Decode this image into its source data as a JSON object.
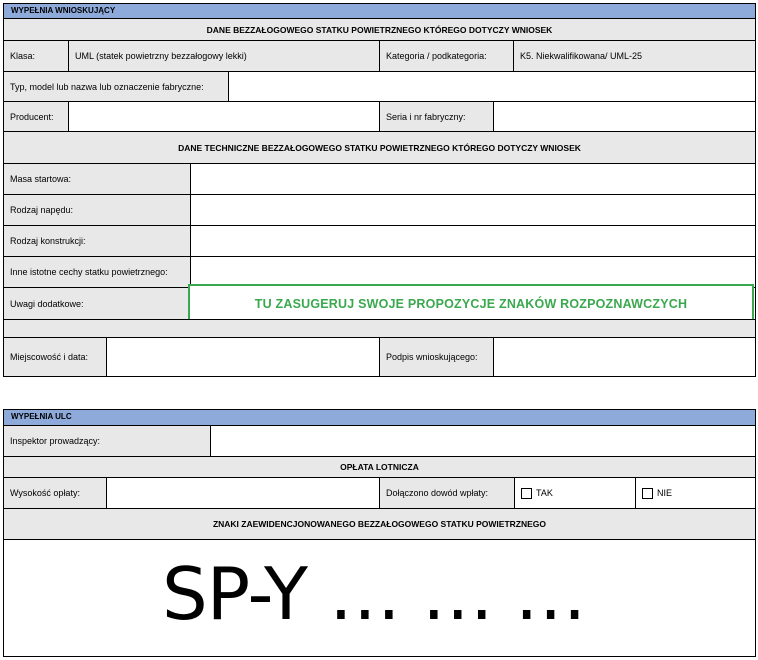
{
  "section1": {
    "header": "WYPEŁNIA WNIOSKUJĄCY",
    "aircraft_heading": "DANE BEZZAŁOGOWEGO STATKU POWIETRZNEGO KTÓREGO DOTYCZY WNIOSEK",
    "klasa_label": "Klasa:",
    "klasa_value": "UML (statek powietrzny bezzałogowy lekki)",
    "kategoria_label": "Kategoria / podkategoria:",
    "kategoria_value": "K5. Niekwalifikowana/ UML-25",
    "typ_label": "Typ, model lub nazwa lub oznaczenie fabryczne:",
    "producent_label": "Producent:",
    "seria_label": "Seria i nr fabryczny:",
    "tech_heading": "DANE TECHNICZNE BEZZAŁOGOWEGO STATKU POWIETRZNEGO KTÓREGO DOTYCZY WNIOSEK",
    "masa_label": "Masa startowa:",
    "naped_label": "Rodzaj napędu:",
    "konstrukcja_label": "Rodzaj konstrukcji:",
    "cechy_label": "Inne istotne cechy statku powietrznego:",
    "uwagi_label": "Uwagi dodatkowe:",
    "uwagi_overlay": "TU ZASUGERUJ SWOJE PROPOZYCJE ZNAKÓW ROZPOZNAWCZYCH",
    "miejscowosc_label": "Miejscowość i data:",
    "podpis_label": "Podpis wnioskującego:"
  },
  "section2": {
    "header": "WYPEŁNIA ULC",
    "inspektor_label": "Inspektor prowadzący:",
    "oplata_heading": "OPŁATA LOTNICZA",
    "wysokosc_label": "Wysokość opłaty:",
    "dowod_label": "Dołączono dowód wpłaty:",
    "tak_label": "TAK",
    "nie_label": "NIE",
    "znaki_heading": "ZNAKI ZAEWIDENCJONOWANEGO BEZZAŁOGOWEGO STATKU POWIETRZNEGO",
    "registration": "SP-Y … … …"
  },
  "colors": {
    "header_bg": "#8eaadb",
    "cell_bg": "#e8e8e8",
    "overlay": "#3aa84e"
  }
}
